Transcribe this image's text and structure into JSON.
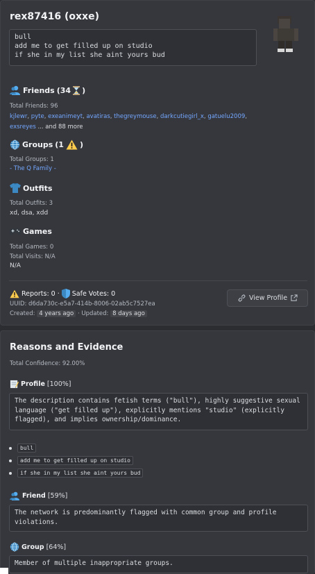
{
  "profile": {
    "username": "rex87416 (oxxe)",
    "description_lines": [
      "bull",
      "add me to get filled up on studio",
      "if she in my list she aint yours bud"
    ]
  },
  "friends": {
    "title": "Friends",
    "count_badge": "(34",
    "icon": "person-icon",
    "status_icon": "hourglass-icon",
    "close_paren": ")",
    "total": "Total Friends: 96",
    "list": [
      "kjlewr",
      "pyte",
      "exeanimeyt",
      "avatiras",
      "thegreymouse",
      "darkcutiegirl_x",
      "gatuelu2009",
      "exsreyes"
    ],
    "more": "... and 88 more"
  },
  "groups": {
    "title": "Groups",
    "count_badge": "(1",
    "close_paren": ")",
    "icon": "globe-icon",
    "status_icon": "warning-icon",
    "total": "Total Groups: 1",
    "list": [
      "- The Q Family -"
    ]
  },
  "outfits": {
    "title": "Outfits",
    "icon": "shirt-icon",
    "total": "Total Outfits: 3",
    "list": "xd, dsa, xdd"
  },
  "games": {
    "title": "Games",
    "icon": "gamepad-icon",
    "total": "Total Games: 0",
    "visits": "Total Visits: N/A",
    "list": "N/A"
  },
  "footer": {
    "reports": "Reports: 0 ·",
    "safe_votes": "Safe Votes: 0",
    "uuid_label": "UUID: d6da730c-e5a7-414b-8006-02ab5c7527ea",
    "created_label": "Created:",
    "created_value": "4 years ago",
    "updated_label": "· Updated:",
    "updated_value": "8 days ago",
    "view_profile": "View Profile"
  },
  "reasons": {
    "title": "Reasons and Evidence",
    "confidence": "Total Confidence: 92.00%",
    "profile": {
      "title": "Profile",
      "pct": "[100%]",
      "icon": "memo-icon",
      "text": "The description contains fetish terms (\"bull\"), highly suggestive sexual language (\"get filled up\"), explicitly mentions \"studio\" (explicitly flagged), and implies ownership/dominance.",
      "evidence": [
        "bull",
        "add me to get filled up on studio",
        "if she in my list she aint yours bud"
      ]
    },
    "friend": {
      "title": "Friend",
      "pct": "[59%]",
      "icon": "person-icon",
      "text": "The network is predominantly flagged with common group and profile violations."
    },
    "group": {
      "title": "Group",
      "pct": "[64%]",
      "icon": "globe-icon",
      "text": "Member of multiple inappropriate groups."
    }
  },
  "colors": {
    "background": "#2b2d31",
    "card": "#36373d",
    "link": "#73a7ff"
  }
}
